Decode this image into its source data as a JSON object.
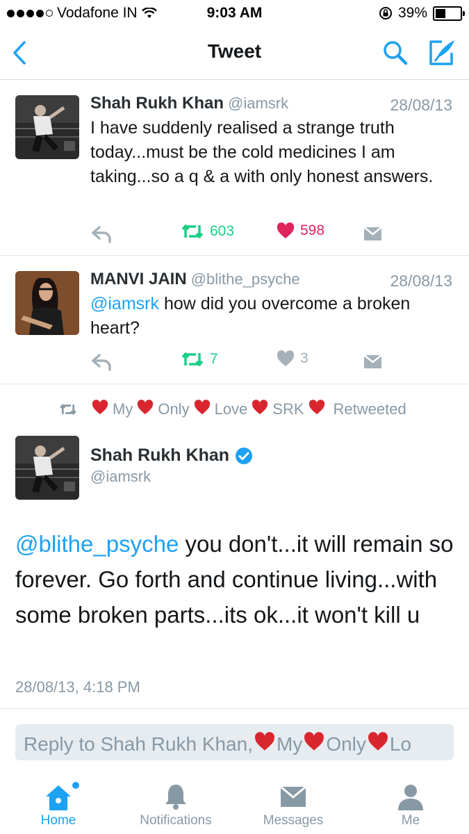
{
  "status_bar": {
    "carrier": "Vodafone IN",
    "time": "9:03 AM",
    "battery": "39%",
    "battery_level": 0.39
  },
  "nav": {
    "title": "Tweet",
    "back_icon": "chevron-left-icon",
    "search_icon": "search-icon",
    "compose_icon": "compose-icon"
  },
  "tweets": [
    {
      "name": "Shah Rukh Khan",
      "handle": "@iamsrk",
      "date": "28/08/13",
      "text": "I have suddenly realised a strange truth today...must be the cold medicines I am taking...so a q & a with only honest answers.",
      "retweets": "603",
      "likes": "598"
    },
    {
      "name": "MANVI JAIN",
      "handle": "@blithe_psyche",
      "date": "28/08/13",
      "mention": "@iamsrk",
      "text": " how did you overcome a broken heart?",
      "retweets": "7",
      "likes": "3"
    }
  ],
  "retweeted_by": {
    "parts": [
      "My",
      "Only",
      "Love",
      "SRK"
    ],
    "suffix": "Retweeted"
  },
  "main_tweet": {
    "name": "Shah Rukh Khan",
    "handle": "@iamsrk",
    "mention": "@blithe_psyche",
    "text": " you don't...it will remain so forever. Go forth and continue living...with some broken parts...its ok...it won't kill u",
    "timestamp": "28/08/13, 4:18 PM"
  },
  "reply": {
    "placeholder_prefix": "Reply to Shah Rukh Khan, ",
    "parts": [
      "My",
      "Only",
      "Lo"
    ]
  },
  "tabs": [
    {
      "label": "Home",
      "icon": "home-icon"
    },
    {
      "label": "Notifications",
      "icon": "bell-icon"
    },
    {
      "label": "Messages",
      "icon": "envelope-icon"
    },
    {
      "label": "Me",
      "icon": "person-icon"
    }
  ],
  "colors": {
    "accent": "#1da1f2",
    "retweet": "#19cf86",
    "like": "#e0245e"
  }
}
